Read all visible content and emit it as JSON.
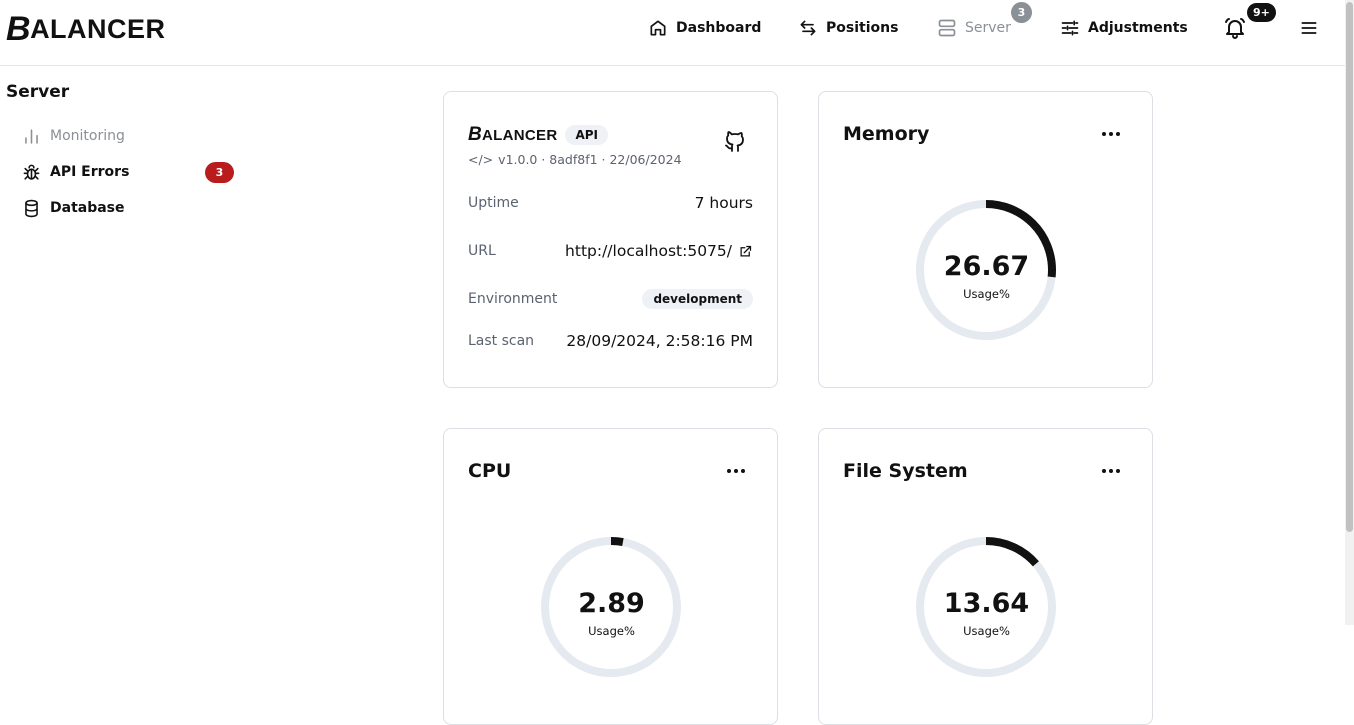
{
  "app": {
    "logo_b": "B",
    "logo_rest": "ALANCER"
  },
  "nav": {
    "dashboard": "Dashboard",
    "positions": "Positions",
    "server": "Server",
    "server_badge": "3",
    "adjustments": "Adjustments",
    "notifications_badge": "9+"
  },
  "sidebar": {
    "title": "Server",
    "items": [
      {
        "label": "Monitoring",
        "icon": "bar-chart-icon"
      },
      {
        "label": "API Errors",
        "icon": "bug-icon",
        "badge": "3"
      },
      {
        "label": "Database",
        "icon": "database-icon"
      }
    ]
  },
  "api_card": {
    "logo_b": "B",
    "logo_rest": "ALANCER",
    "tag": "API",
    "code_symbol": "</>",
    "version_line": "v1.0.0 · 8adf8f1 · 22/06/2024",
    "rows": {
      "uptime": {
        "label": "Uptime",
        "value": "7 hours"
      },
      "url": {
        "label": "URL",
        "value": "http://localhost:5075/"
      },
      "environment": {
        "label": "Environment",
        "value": "development"
      },
      "last_scan": {
        "label": "Last scan",
        "value": "28/09/2024, 2:58:16 PM"
      }
    }
  },
  "memory": {
    "title": "Memory",
    "value": "26.67",
    "label": "Usage%",
    "percent": 26.67
  },
  "cpu": {
    "title": "CPU",
    "value": "2.89",
    "label": "Usage%",
    "percent": 2.89
  },
  "filesystem": {
    "title": "File System",
    "value": "13.64",
    "label": "Usage%",
    "percent": 13.64
  },
  "colors": {
    "accent": "#111111",
    "track": "#e5e9f0",
    "danger": "#b91c1c",
    "muted": "#8b8f96"
  }
}
